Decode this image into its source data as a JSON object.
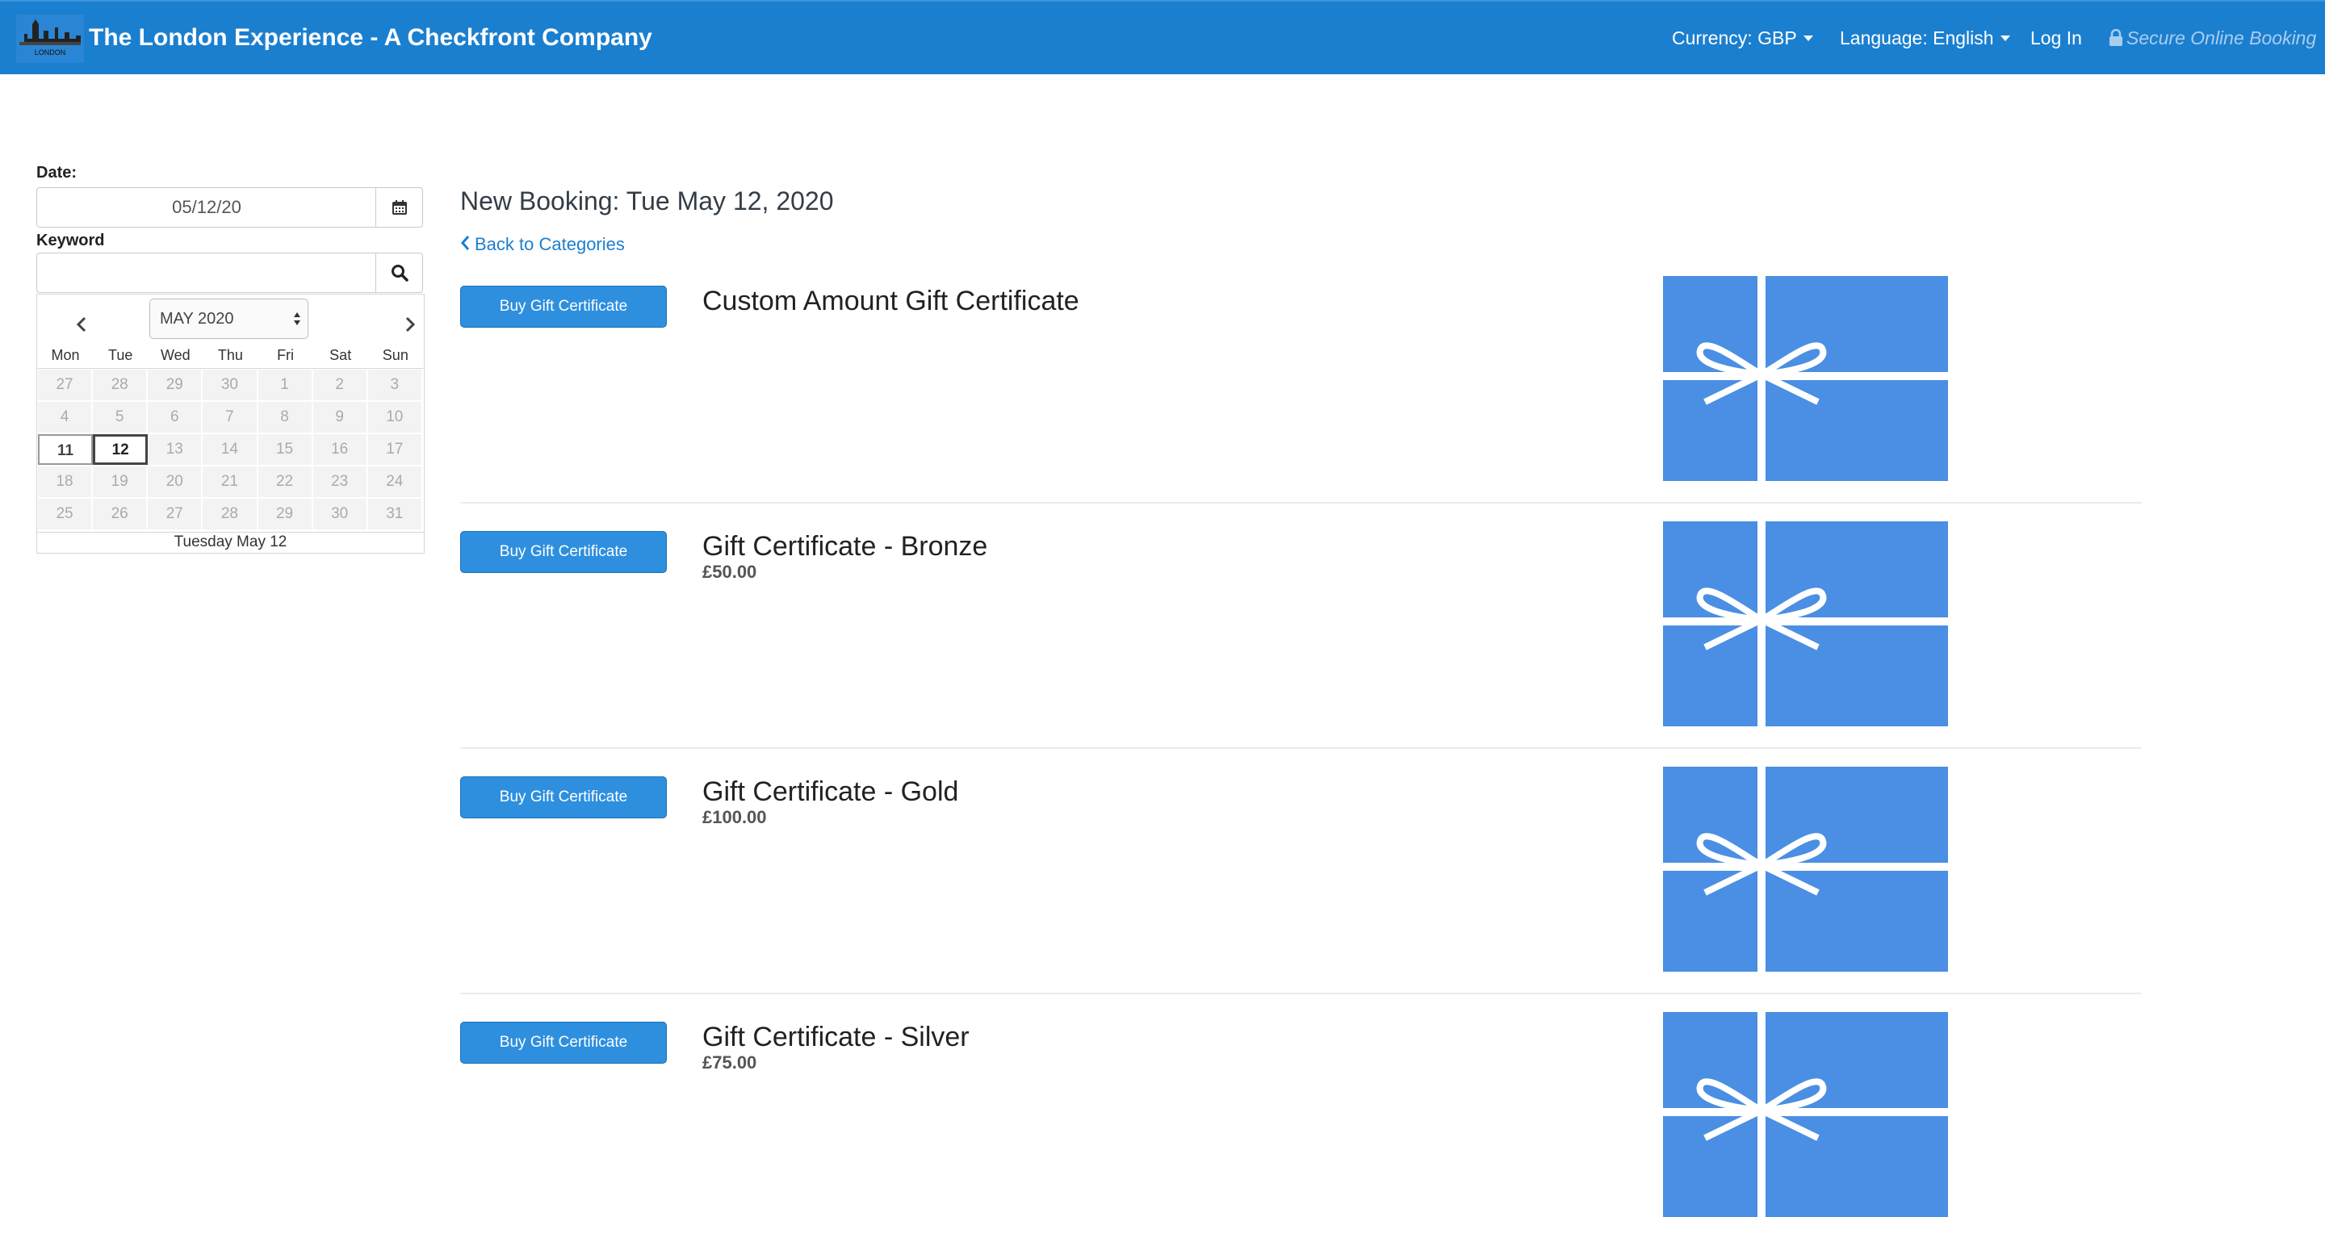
{
  "navbar": {
    "logo_text": "LONDON",
    "brand": "The London Experience - A Checkfront Company",
    "currency": "Currency: GBP",
    "language": "Language: English",
    "login": "Log In",
    "secure": "Secure Online Booking"
  },
  "sidebar": {
    "date_label": "Date:",
    "date_value": "05/12/20",
    "keyword_label": "Keyword",
    "keyword_value": "",
    "calendar": {
      "month": "MAY 2020",
      "days_of_week": [
        "Mon",
        "Tue",
        "Wed",
        "Thu",
        "Fri",
        "Sat",
        "Sun"
      ],
      "weeks": [
        [
          "27",
          "28",
          "29",
          "30",
          "1",
          "2",
          "3"
        ],
        [
          "4",
          "5",
          "6",
          "7",
          "8",
          "9",
          "10"
        ],
        [
          "11",
          "12",
          "13",
          "14",
          "15",
          "16",
          "17"
        ],
        [
          "18",
          "19",
          "20",
          "21",
          "22",
          "23",
          "24"
        ],
        [
          "25",
          "26",
          "27",
          "28",
          "29",
          "30",
          "31"
        ]
      ],
      "footer": "Tuesday May 12"
    }
  },
  "main": {
    "heading": "New Booking: Tue May 12, 2020",
    "back_link": "Back to Categories",
    "items": [
      {
        "button": "Buy Gift Certificate",
        "title": "Custom Amount Gift Certificate",
        "price": ""
      },
      {
        "button": "Buy Gift Certificate",
        "title": "Gift Certificate - Bronze",
        "price": "£50.00"
      },
      {
        "button": "Buy Gift Certificate",
        "title": "Gift Certificate - Gold",
        "price": "£100.00"
      },
      {
        "button": "Buy Gift Certificate",
        "title": "Gift Certificate - Silver",
        "price": "£75.00"
      }
    ]
  },
  "colors": {
    "navbar": "#1b7fcf",
    "button": "#2e8fde",
    "gift_card": "#4a8fe3"
  }
}
